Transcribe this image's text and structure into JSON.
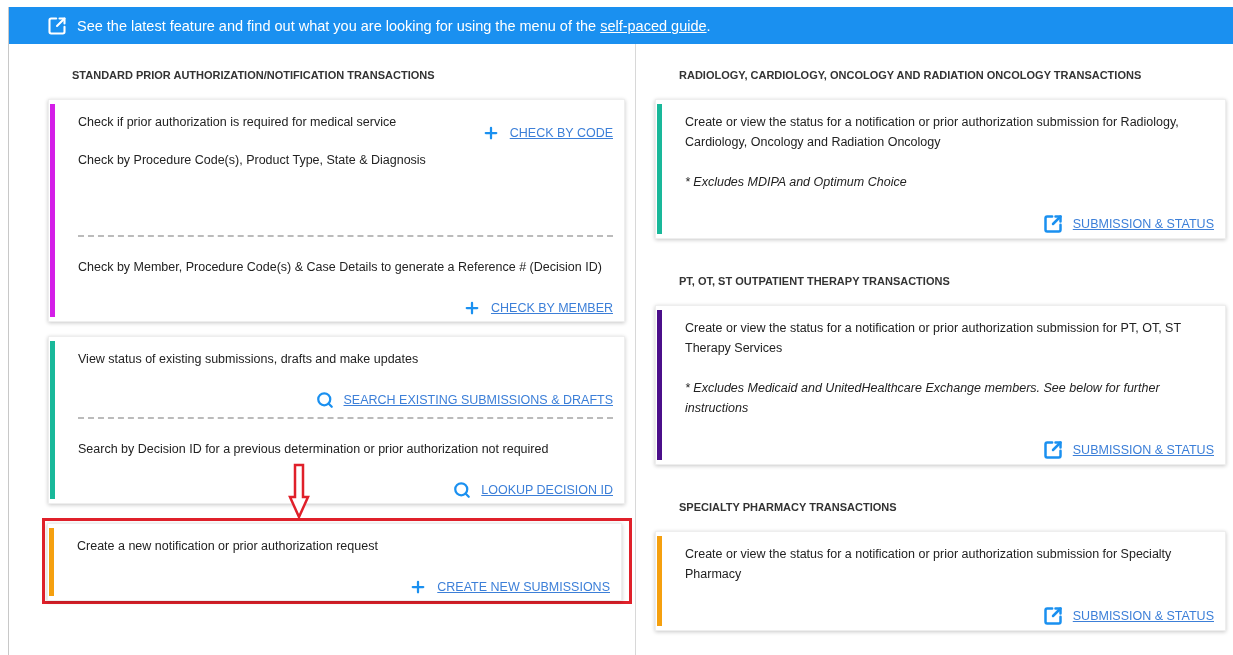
{
  "banner": {
    "text": "See the latest feature and find out what you are looking for using the menu of the ",
    "link": "self-paced guide",
    "after": "."
  },
  "columns": [
    {
      "groups": [
        {
          "heading": "STANDARD PRIOR AUTHORIZATION/NOTIFICATION TRANSACTIONS",
          "cards": [
            {
              "color": "#d41ee8",
              "highlighted": false,
              "sections": [
                {
                  "kind": "inline",
                  "texts": [
                    "Check if prior authorization is required for medical service",
                    "Check by Procedure Code(s), Product Type, State & Diagnosis"
                  ],
                  "action": {
                    "kind": "plus",
                    "label": "CHECK BY CODE"
                  }
                },
                {
                  "kind": "stacked",
                  "texts": [
                    "Check by Member, Procedure Code(s) & Case Details to generate a Reference # (Decision ID)"
                  ],
                  "action": {
                    "kind": "plus",
                    "label": "CHECK BY MEMBER"
                  }
                }
              ]
            },
            {
              "color": "#19b89a",
              "highlighted": false,
              "sections": [
                {
                  "kind": "stacked",
                  "texts": [
                    "View status of existing submissions, drafts and make updates"
                  ],
                  "action": {
                    "kind": "search",
                    "label": "SEARCH EXISTING SUBMISSIONS & DRAFTS"
                  }
                },
                {
                  "kind": "stacked",
                  "texts": [
                    "Search by Decision ID for a previous determination or prior authorization not required"
                  ],
                  "action": {
                    "kind": "search",
                    "label": "LOOKUP DECISION ID"
                  }
                }
              ]
            },
            {
              "color": "#f5a00f",
              "highlighted": true,
              "sections": [
                {
                  "kind": "stacked",
                  "texts": [
                    "Create a new notification or prior authorization request"
                  ],
                  "action": {
                    "kind": "plus",
                    "label": "CREATE NEW SUBMISSIONS"
                  }
                }
              ]
            }
          ]
        }
      ]
    },
    {
      "groups": [
        {
          "heading": "RADIOLOGY, CARDIOLOGY, ONCOLOGY AND RADIATION ONCOLOGY TRANSACTIONS",
          "cards": [
            {
              "color": "#19b89a",
              "highlighted": false,
              "sections": [
                {
                  "kind": "stacked",
                  "texts": [
                    "Create or view the status for a notification or prior authorization submission for Radiology, Cardiology, Oncology and Radiation Oncology"
                  ],
                  "note": "* Excludes MDIPA and Optimum Choice",
                  "action": {
                    "kind": "external",
                    "label": "SUBMISSION & STATUS"
                  }
                }
              ]
            }
          ]
        },
        {
          "heading": "PT, OT, ST OUTPATIENT THERAPY TRANSACTIONS",
          "cards": [
            {
              "color": "#4b0f8a",
              "highlighted": false,
              "sections": [
                {
                  "kind": "stacked",
                  "texts": [
                    "Create or view the status for a notification or prior authorization submission for PT, OT, ST Therapy Services"
                  ],
                  "note": "* Excludes Medicaid and UnitedHealthcare Exchange members. See below for further instructions",
                  "action": {
                    "kind": "external",
                    "label": "SUBMISSION & STATUS"
                  }
                }
              ]
            }
          ]
        },
        {
          "heading": "SPECIALTY PHARMACY TRANSACTIONS",
          "cards": [
            {
              "color": "#f5a00f",
              "highlighted": false,
              "sections": [
                {
                  "kind": "stacked",
                  "texts": [
                    "Create or view the status for a notification or prior authorization submission for Specialty Pharmacy"
                  ],
                  "action": {
                    "kind": "external",
                    "label": "SUBMISSION & STATUS"
                  }
                }
              ]
            }
          ]
        }
      ]
    }
  ]
}
